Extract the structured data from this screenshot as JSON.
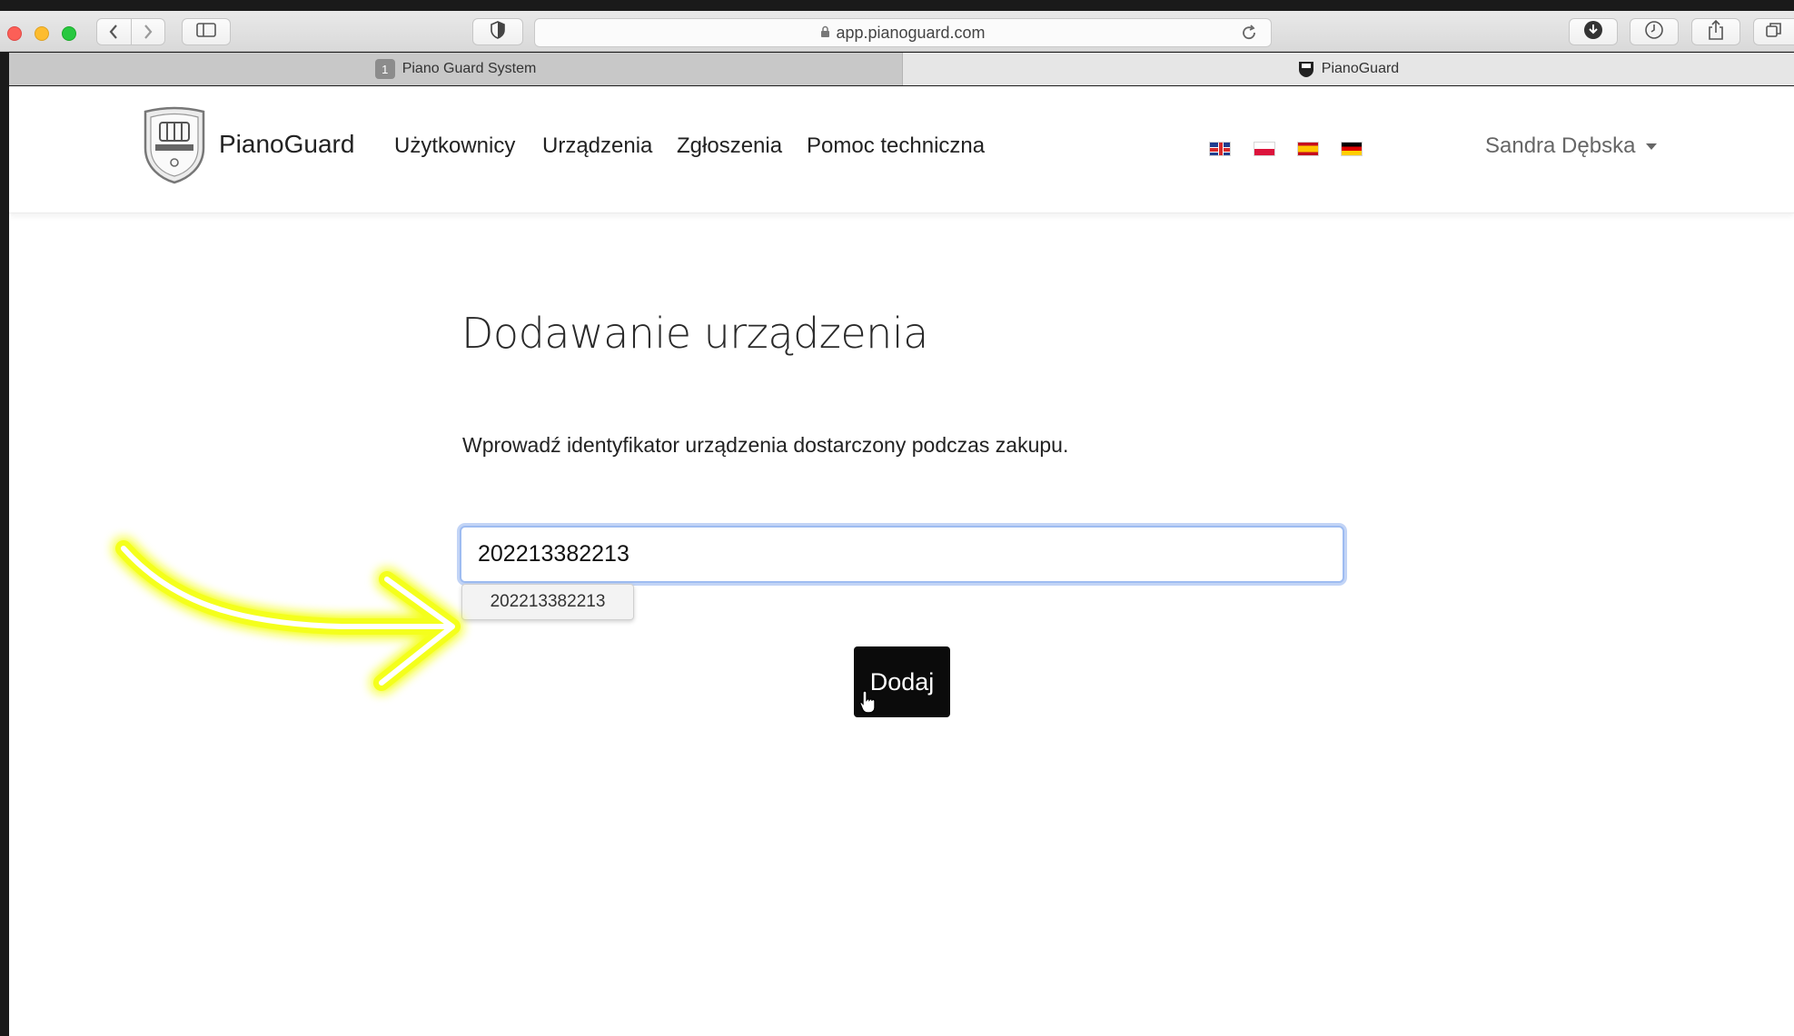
{
  "browser": {
    "url": "app.pianoguard.com",
    "tabs": [
      {
        "badge": "1",
        "label": "Piano Guard System",
        "active": false
      },
      {
        "label": "PianoGuard",
        "active": true
      }
    ]
  },
  "navbar": {
    "brand": "PianoGuard",
    "links": [
      "Użytkownicy",
      "Urządzenia",
      "Zgłoszenia",
      "Pomoc techniczna"
    ],
    "languages": [
      "en",
      "pl",
      "es",
      "de"
    ],
    "user_name": "Sandra Dębska"
  },
  "form": {
    "title": "Dodawanie urządzenia",
    "instruction": "Wprowadź identyfikator urządzenia dostarczony podczas zakupu.",
    "device_id_value": "202213382213",
    "autocomplete_suggestion": "202213382213",
    "submit_label": "Dodaj"
  },
  "colors": {
    "annotation_arrow": "#f4ff1a",
    "input_focus_border": "#9ebcf1",
    "submit_button_bg": "#0b0b0b"
  }
}
